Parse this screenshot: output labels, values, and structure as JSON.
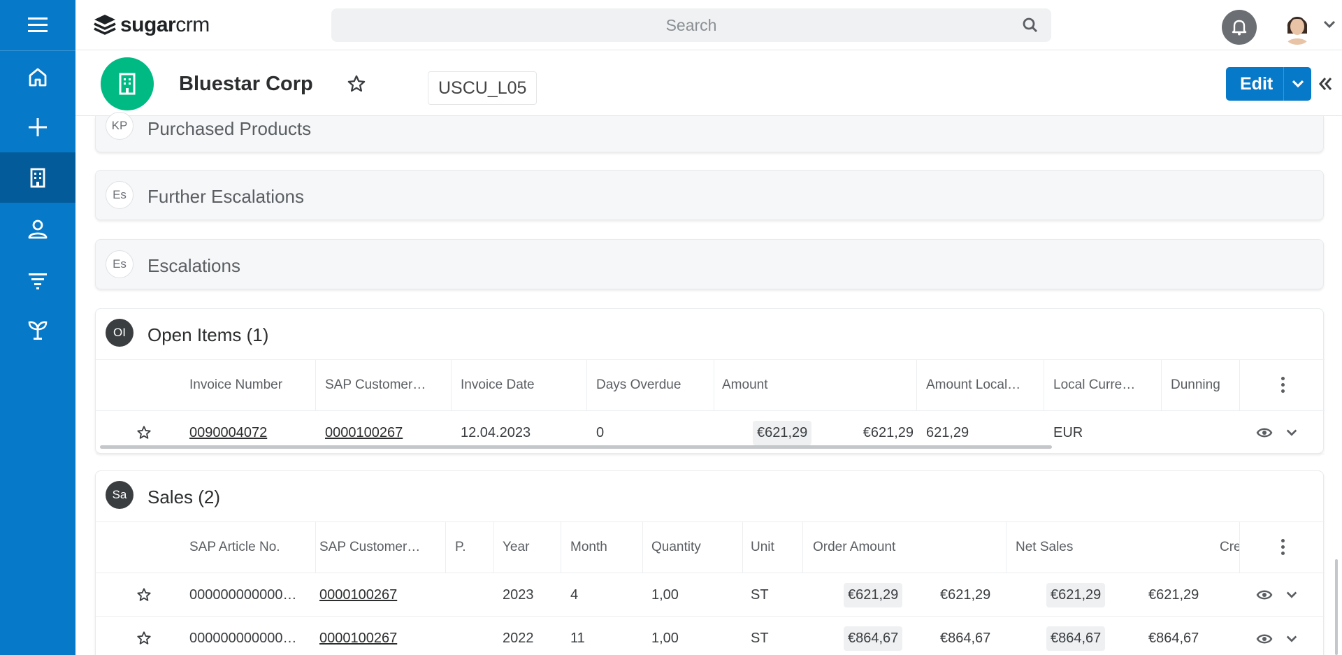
{
  "brand": {
    "logo_bold": "sugar",
    "logo_light": "crm"
  },
  "search": {
    "placeholder": "Search"
  },
  "colors": {
    "primary": "#0679c8",
    "sidebar_active": "#045b99",
    "record_icon": "#00ba83"
  },
  "sidebar": {
    "items": [
      {
        "name": "menu",
        "icon": "hamburger-icon"
      },
      {
        "name": "home",
        "icon": "home-icon"
      },
      {
        "name": "create",
        "icon": "plus-icon"
      },
      {
        "name": "accounts",
        "icon": "building-icon",
        "active": true
      },
      {
        "name": "contacts",
        "icon": "person-icon"
      },
      {
        "name": "filter",
        "icon": "filter-icon"
      },
      {
        "name": "sprout",
        "icon": "sprout-icon"
      }
    ]
  },
  "record": {
    "name": "Bluestar Corp",
    "tag": "USCU_L05",
    "edit_label": "Edit"
  },
  "panels": {
    "purchased": {
      "badge": "KP",
      "title": "Purchased Products"
    },
    "further": {
      "badge": "Es",
      "title": "Further Escalations"
    },
    "escalations": {
      "badge": "Es",
      "title": "Escalations"
    },
    "open_items": {
      "badge": "OI",
      "title": "Open Items (1)",
      "headers": [
        "Invoice Number",
        "SAP Customer…",
        "Invoice Date",
        "Days Overdue",
        "Amount",
        "Amount Local…",
        "Local Curre…",
        "Dunning"
      ],
      "rows": [
        {
          "invoice": "0090004072",
          "customer": "0000100267",
          "date": "12.04.2023",
          "overdue": "0",
          "amount_pill": "€621,29",
          "amount": "€621,29",
          "amount_local": "621,29",
          "currency": "EUR"
        }
      ]
    },
    "sales": {
      "badge": "Sa",
      "title": "Sales (2)",
      "headers": [
        "SAP Article No.",
        "SAP Customer…",
        "P.",
        "Year",
        "Month",
        "Quantity",
        "Unit",
        "Order Amount",
        "Net Sales",
        "Cre"
      ],
      "rows": [
        {
          "article": "000000000000…",
          "customer": "0000100267",
          "year": "2023",
          "month": "4",
          "quantity": "1,00",
          "unit": "ST",
          "order_pill": "€621,29",
          "order": "€621,29",
          "net_pill": "€621,29",
          "net": "€621,29"
        },
        {
          "article": "000000000000…",
          "customer": "0000100267",
          "year": "2022",
          "month": "11",
          "quantity": "1,00",
          "unit": "ST",
          "order_pill": "€864,67",
          "order": "€864,67",
          "net_pill": "€864,67",
          "net": "€864,67"
        }
      ]
    }
  }
}
